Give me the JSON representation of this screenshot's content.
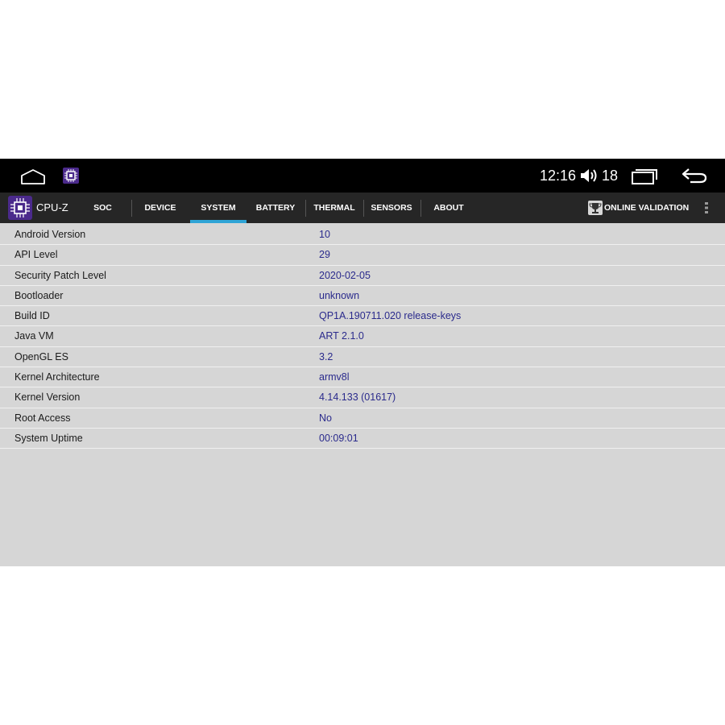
{
  "status_bar": {
    "time": "12:16",
    "volume_level": "18",
    "icons": [
      "home-icon",
      "cpu-z-app-icon",
      "volume-icon",
      "recents-icon",
      "back-icon"
    ]
  },
  "app": {
    "name": "CPU-Z",
    "accent_color": "#2fa4d6",
    "logo_color": "#4b2a8c"
  },
  "tabs": [
    {
      "label": "SOC"
    },
    {
      "label": "DEVICE"
    },
    {
      "label": "SYSTEM",
      "active": true
    },
    {
      "label": "BATTERY"
    },
    {
      "label": "THERMAL"
    },
    {
      "label": "SENSORS"
    },
    {
      "label": "ABOUT"
    }
  ],
  "toolbar": {
    "validation_label": "ONLINE VALIDATION"
  },
  "system_info": [
    {
      "label": "Android Version",
      "value": "10"
    },
    {
      "label": "API Level",
      "value": "29"
    },
    {
      "label": "Security Patch Level",
      "value": "2020-02-05"
    },
    {
      "label": "Bootloader",
      "value": "unknown"
    },
    {
      "label": "Build ID",
      "value": "QP1A.190711.020 release-keys"
    },
    {
      "label": "Java VM",
      "value": "ART 2.1.0"
    },
    {
      "label": "OpenGL ES",
      "value": "3.2"
    },
    {
      "label": "Kernel Architecture",
      "value": "armv8l"
    },
    {
      "label": "Kernel Version",
      "value": "4.14.133 (01617)"
    },
    {
      "label": "Root Access",
      "value": "No"
    },
    {
      "label": "System Uptime",
      "value": "00:09:01"
    }
  ]
}
